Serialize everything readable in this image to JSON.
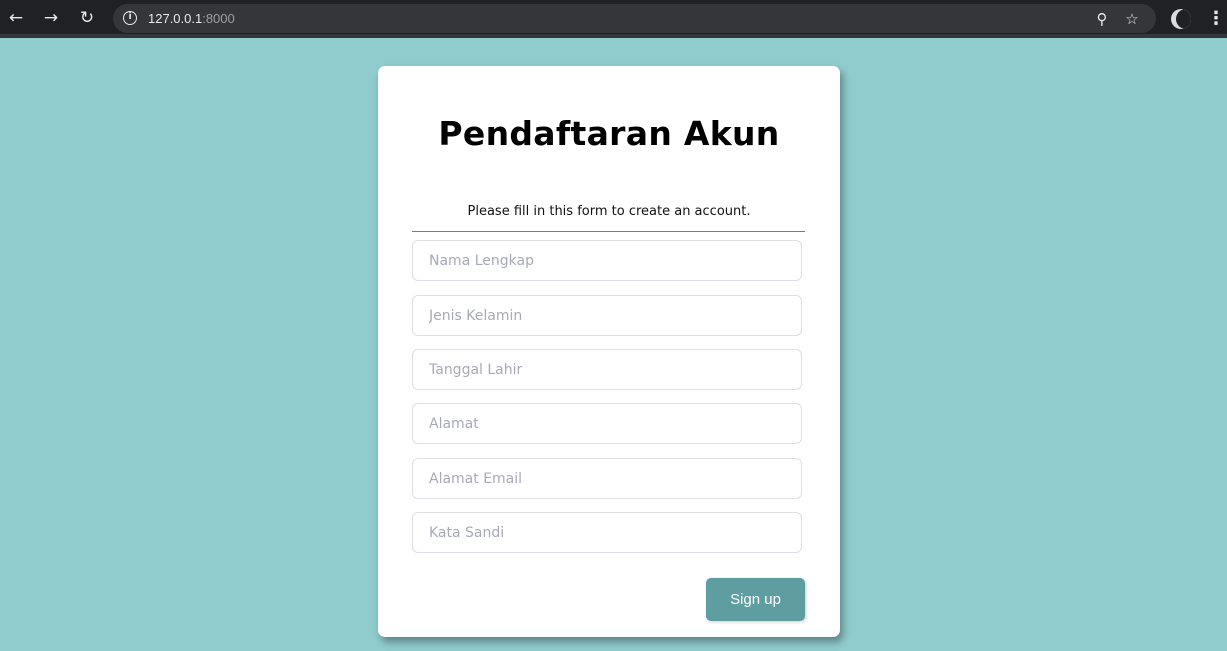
{
  "browser": {
    "url_host": "127.0.0.1",
    "url_port": ":8000",
    "back_icon": "←",
    "forward_icon": "→",
    "reload_icon": "↻",
    "info_icon": "i",
    "zoom_icon": "⚲",
    "star_icon": "☆",
    "menu_icon": "⋮"
  },
  "form": {
    "title": "Pendaftaran Akun",
    "subtitle": "Please fill in this form to create an account.",
    "fields": [
      {
        "placeholder": "Nama Lengkap",
        "value": ""
      },
      {
        "placeholder": "Jenis Kelamin",
        "value": ""
      },
      {
        "placeholder": "Tanggal Lahir",
        "value": ""
      },
      {
        "placeholder": "Alamat",
        "value": ""
      },
      {
        "placeholder": "Alamat Email",
        "value": ""
      },
      {
        "placeholder": "Kata Sandi",
        "value": ""
      }
    ],
    "submit_label": "Sign up"
  },
  "colors": {
    "page_background": "#90cbcd",
    "button": "#5f9ea0",
    "card": "#ffffff"
  }
}
